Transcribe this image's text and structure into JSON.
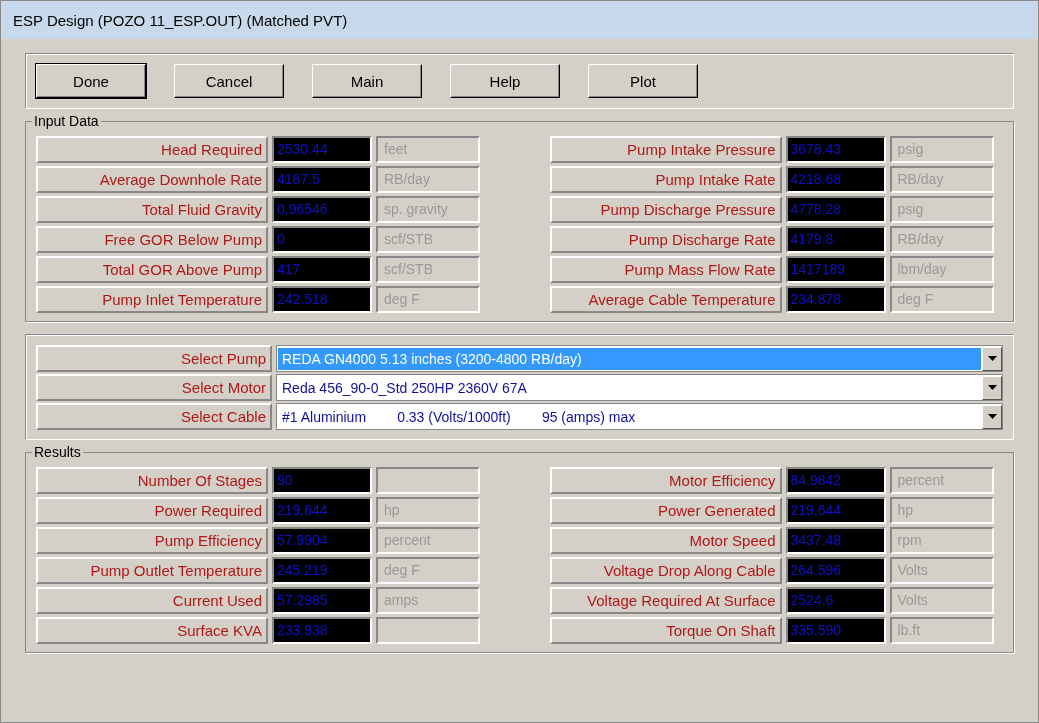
{
  "window": {
    "title": "ESP Design (POZO 11_ESP.OUT) (Matched PVT)"
  },
  "buttons": [
    "Done",
    "Cancel",
    "Main",
    "Help",
    "Plot"
  ],
  "input_data": {
    "title": "Input Data",
    "left": [
      {
        "label": "Head Required",
        "value": "2530.44",
        "unit": "feet"
      },
      {
        "label": "Average Downhole Rate",
        "value": "4187.5",
        "unit": "RB/day"
      },
      {
        "label": "Total Fluid Gravity",
        "value": "0.96546",
        "unit": "sp. gravity"
      },
      {
        "label": "Free GOR Below Pump",
        "value": "0",
        "unit": "scf/STB"
      },
      {
        "label": "Total GOR Above Pump",
        "value": "417",
        "unit": "scf/STB"
      },
      {
        "label": "Pump Inlet Temperature",
        "value": "242.518",
        "unit": "deg F"
      }
    ],
    "right": [
      {
        "label": "Pump Intake Pressure",
        "value": "3678.43",
        "unit": "psig"
      },
      {
        "label": "Pump Intake Rate",
        "value": "4218.68",
        "unit": "RB/day"
      },
      {
        "label": "Pump Discharge Pressure",
        "value": "4778.28",
        "unit": "psig"
      },
      {
        "label": "Pump Discharge Rate",
        "value": "4179.8",
        "unit": "RB/day"
      },
      {
        "label": "Pump Mass Flow Rate",
        "value": "1417189",
        "unit": "lbm/day"
      },
      {
        "label": "Average Cable Temperature",
        "value": "234.878",
        "unit": "deg F"
      }
    ]
  },
  "selects": [
    {
      "label": "Select Pump",
      "value": "REDA GN4000 5.13 inches (3200-4800 RB/day)",
      "selected": true
    },
    {
      "label": "Select Motor",
      "value": "Reda 456_90-0_Std 250HP 2360V 67A",
      "selected": false
    },
    {
      "label": "Select Cable",
      "value": "#1 Aluminium        0.33 (Volts/1000ft)        95 (amps) max",
      "selected": false
    }
  ],
  "results": {
    "title": "Results",
    "left": [
      {
        "label": "Number Of Stages",
        "value": "90"
      },
      {
        "label": "Power Required",
        "value": "219.644",
        "unit": "hp"
      },
      {
        "label": "Pump Efficiency",
        "value": "57.9904",
        "unit": "percent"
      },
      {
        "label": "Pump Outlet Temperature",
        "value": "245.219",
        "unit": "deg F"
      },
      {
        "label": "Current Used",
        "value": "57.2985",
        "unit": "amps"
      },
      {
        "label": "Surface KVA",
        "value": "233.938"
      }
    ],
    "right": [
      {
        "label": "Motor Efficiency",
        "value": "84.9842",
        "unit": "percent"
      },
      {
        "label": "Power Generated",
        "value": "219.644",
        "unit": "hp"
      },
      {
        "label": "Motor Speed",
        "value": "3437.48",
        "unit": "rpm"
      },
      {
        "label": "Voltage Drop Along Cable",
        "value": "264.596",
        "unit": "Volts"
      },
      {
        "label": "Voltage Required At Surface",
        "value": "2524.6",
        "unit": "Volts"
      },
      {
        "label": "Torque On Shaft",
        "value": "335.590",
        "unit": "lb.ft"
      }
    ]
  }
}
